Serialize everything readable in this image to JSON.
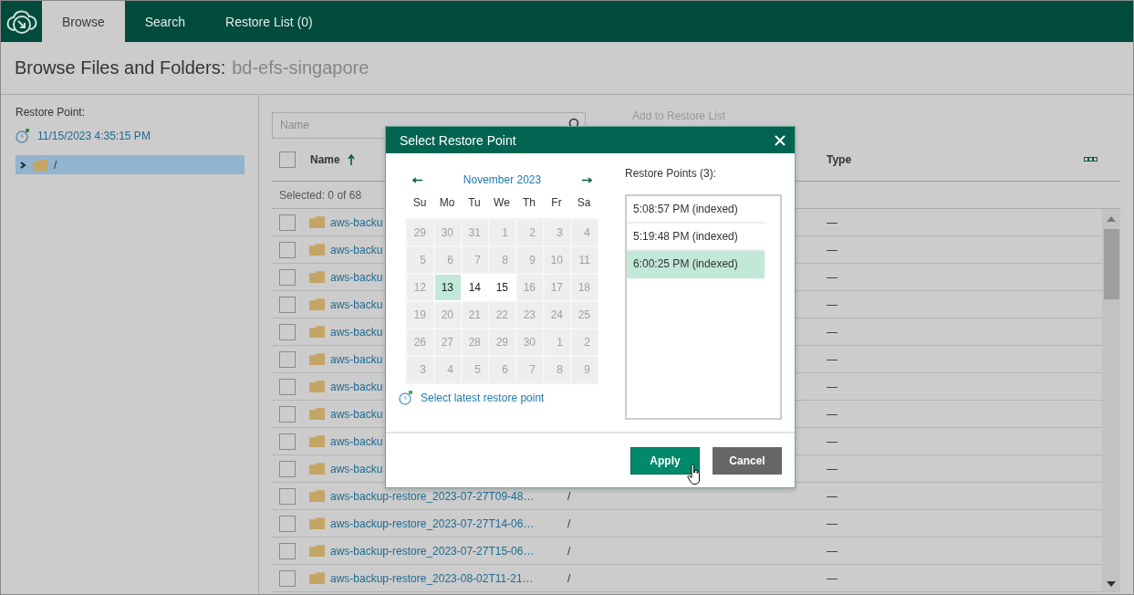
{
  "app": {
    "tabs": [
      {
        "label": "Browse",
        "selected": true
      },
      {
        "label": "Search",
        "selected": false
      },
      {
        "label": "Restore List (0)",
        "selected": false
      }
    ]
  },
  "page_title": {
    "label": "Browse Files and Folders:",
    "source": "bd-efs-singapore"
  },
  "sidebar": {
    "restore_point_label": "Restore Point:",
    "restore_point": "11/15/2023 4:35:15 PM",
    "tree": [
      {
        "label": "/",
        "selected": true,
        "expanded": false
      }
    ]
  },
  "toolbar": {
    "search": {
      "placeholder": "Name"
    },
    "add_button": "Add to Restore List"
  },
  "table": {
    "columns": [
      {
        "label": "Name",
        "sorted": true
      },
      {
        "label": "Type"
      }
    ],
    "select_all_checked": false,
    "selection": "Selected: 0 of 68",
    "rows": [
      {
        "name": "aws-backu",
        "type": "—",
        "checked": false
      },
      {
        "name": "aws-backu",
        "type": "—",
        "checked": false
      },
      {
        "name": "aws-backu",
        "type": "—",
        "checked": false
      },
      {
        "name": "aws-backu",
        "type": "—",
        "checked": false
      },
      {
        "name": "aws-backu",
        "type": "—",
        "checked": false
      },
      {
        "name": "aws-backu",
        "type": "—",
        "checked": false
      },
      {
        "name": "aws-backu",
        "type": "—",
        "checked": false
      },
      {
        "name": "aws-backu",
        "type": "—",
        "checked": false
      },
      {
        "name": "aws-backu",
        "type": "—",
        "checked": false
      },
      {
        "name": "aws-backu",
        "type": "—",
        "checked": false
      },
      {
        "name": "aws-backup-restore_2023-07-27T09-48…",
        "path": "/",
        "type": "—",
        "checked": false
      },
      {
        "name": "aws-backup-restore_2023-07-27T14-06…",
        "path": "/",
        "type": "—",
        "checked": false
      },
      {
        "name": "aws-backup-restore_2023-07-27T15-06…",
        "path": "/",
        "type": "—",
        "checked": false
      },
      {
        "name": "aws-backup-restore_2023-08-02T11-21…",
        "path": "/",
        "type": "—",
        "checked": false
      }
    ]
  },
  "dialog": {
    "title": "Select Restore Point",
    "month": "November 2023",
    "weekdays": [
      "Su",
      "Mo",
      "Tu",
      "We",
      "Th",
      "Fr",
      "Sa"
    ],
    "weeks": [
      [
        {
          "day": "29",
          "available": false,
          "selected": false
        },
        {
          "day": "30",
          "available": false,
          "selected": false
        },
        {
          "day": "31",
          "available": false,
          "selected": false
        },
        {
          "day": "1",
          "available": false,
          "selected": false
        },
        {
          "day": "2",
          "available": false,
          "selected": false
        },
        {
          "day": "3",
          "available": false,
          "selected": false
        },
        {
          "day": "4",
          "available": false,
          "selected": false
        }
      ],
      [
        {
          "day": "5",
          "available": false,
          "selected": false
        },
        {
          "day": "6",
          "available": false,
          "selected": false
        },
        {
          "day": "7",
          "available": false,
          "selected": false
        },
        {
          "day": "8",
          "available": false,
          "selected": false
        },
        {
          "day": "9",
          "available": false,
          "selected": false
        },
        {
          "day": "10",
          "available": false,
          "selected": false
        },
        {
          "day": "11",
          "available": false,
          "selected": false
        }
      ],
      [
        {
          "day": "12",
          "available": false,
          "selected": false
        },
        {
          "day": "13",
          "available": true,
          "selected": true
        },
        {
          "day": "14",
          "available": true,
          "selected": false
        },
        {
          "day": "15",
          "available": true,
          "selected": false
        },
        {
          "day": "16",
          "available": false,
          "selected": false
        },
        {
          "day": "17",
          "available": false,
          "selected": false
        },
        {
          "day": "18",
          "available": false,
          "selected": false
        }
      ],
      [
        {
          "day": "19",
          "available": false,
          "selected": false
        },
        {
          "day": "20",
          "available": false,
          "selected": false
        },
        {
          "day": "21",
          "available": false,
          "selected": false
        },
        {
          "day": "22",
          "available": false,
          "selected": false
        },
        {
          "day": "23",
          "available": false,
          "selected": false
        },
        {
          "day": "24",
          "available": false,
          "selected": false
        },
        {
          "day": "25",
          "available": false,
          "selected": false
        }
      ],
      [
        {
          "day": "26",
          "available": false,
          "selected": false
        },
        {
          "day": "27",
          "available": false,
          "selected": false
        },
        {
          "day": "28",
          "available": false,
          "selected": false
        },
        {
          "day": "29",
          "available": false,
          "selected": false
        },
        {
          "day": "30",
          "available": false,
          "selected": false
        },
        {
          "day": "1",
          "available": false,
          "selected": false
        },
        {
          "day": "2",
          "available": false,
          "selected": false
        }
      ],
      [
        {
          "day": "3",
          "available": false,
          "selected": false
        },
        {
          "day": "4",
          "available": false,
          "selected": false
        },
        {
          "day": "5",
          "available": false,
          "selected": false
        },
        {
          "day": "6",
          "available": false,
          "selected": false
        },
        {
          "day": "7",
          "available": false,
          "selected": false
        },
        {
          "day": "8",
          "available": false,
          "selected": false
        },
        {
          "day": "9",
          "available": false,
          "selected": false
        }
      ]
    ],
    "latest_link": "Select latest restore point",
    "points_label": "Restore Points (3):",
    "points": [
      {
        "label": "5:08:57 PM (indexed)",
        "selected": false
      },
      {
        "label": "5:19:48 PM (indexed)",
        "selected": false
      },
      {
        "label": "6:00:25 PM (indexed)",
        "selected": true
      }
    ],
    "buttons": [
      "Apply",
      "Cancel"
    ]
  }
}
